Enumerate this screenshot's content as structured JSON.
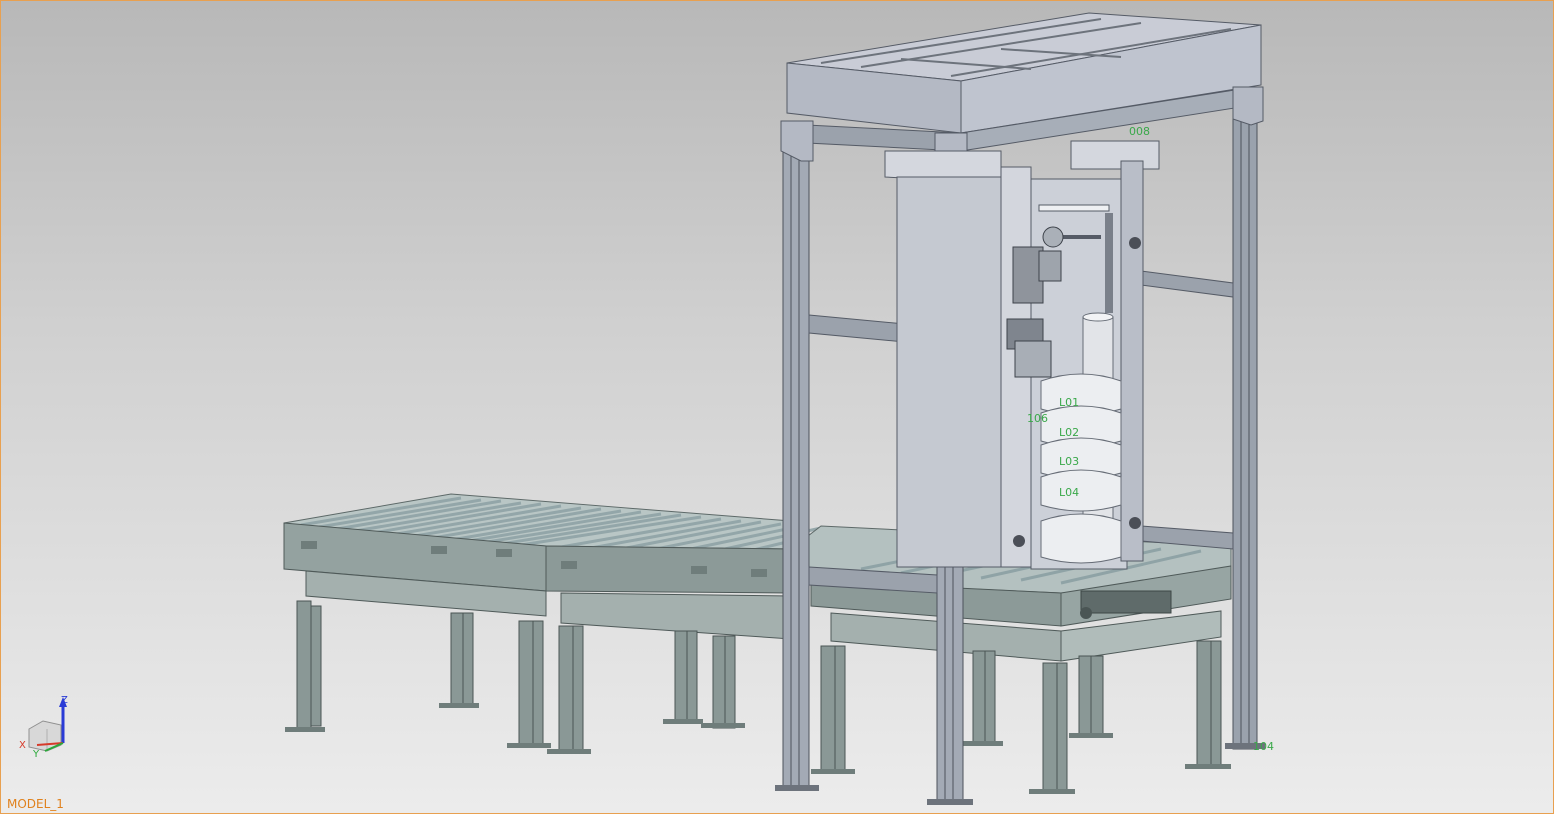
{
  "viewport": {
    "model_name": "MODEL_1",
    "background_top": "#b8b8b8",
    "background_bottom": "#ececec",
    "border_color": "#e8a050"
  },
  "triad": {
    "z_label": "Z",
    "x_label": "X",
    "y_label": "Y",
    "z_color": "#2a3bd6",
    "x_color": "#d63a2a",
    "y_color": "#2aa83a"
  },
  "annotations": {
    "tag_106": "106",
    "tag_104": "104",
    "tag_top": "008",
    "layer_labels": [
      "L01",
      "L02",
      "L03",
      "L04"
    ]
  },
  "colors": {
    "conveyor": "#9aa8a6",
    "conveyor_dark": "#6f7d7b",
    "roller": "#b8cbd0",
    "frame": "#a9b1bc",
    "frame_dark": "#6d737c",
    "column": "#c9cdd4",
    "pmi": "#3aa84a"
  }
}
